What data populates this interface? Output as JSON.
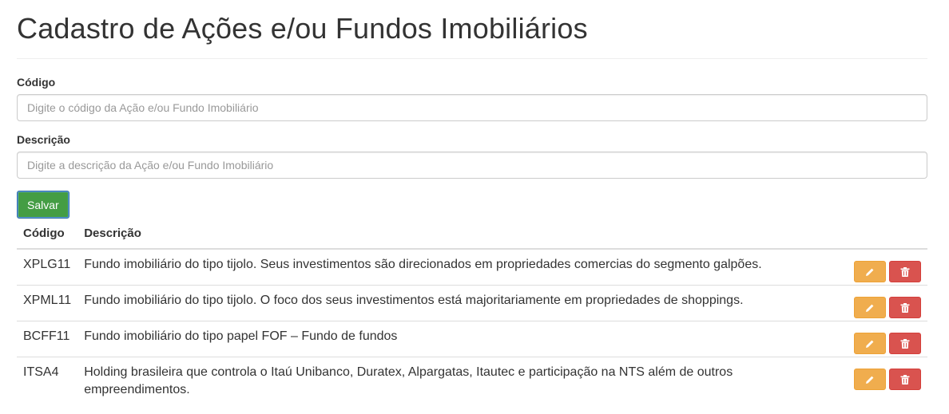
{
  "page": {
    "title": "Cadastro de Ações e/ou Fundos Imobiliários"
  },
  "form": {
    "code_label": "Código",
    "code_placeholder": "Digite o código da Ação e/ou Fundo Imobiliário",
    "code_value": "",
    "description_label": "Descrição",
    "description_placeholder": "Digite a descrição da Ação e/ou Fundo Imobiliário",
    "description_value": "",
    "save_label": "Salvar"
  },
  "table": {
    "headers": {
      "code": "Código",
      "description": "Descrição"
    },
    "rows": [
      {
        "code": "XPLG11",
        "description": "Fundo imobiliário do tipo tijolo. Seus investimentos são direcionados em propriedades comercias do segmento galpões."
      },
      {
        "code": "XPML11",
        "description": "Fundo imobiliário do tipo tijolo. O foco dos seus investimentos está majoritariamente em propriedades de shoppings."
      },
      {
        "code": "BCFF11",
        "description": "Fundo imobiliário do tipo papel FOF – Fundo de fundos"
      },
      {
        "code": "ITSA4",
        "description": "Holding brasileira que controla o Itaú Unibanco, Duratex, Alpargatas, Itautec e participação na NTS além de outros empreendimentos."
      }
    ]
  },
  "icons": {
    "edit": "pencil-icon",
    "delete": "trash-icon"
  },
  "colors": {
    "save_button": "#449d44",
    "edit_button": "#f0ad4e",
    "delete_button": "#d9534f"
  }
}
